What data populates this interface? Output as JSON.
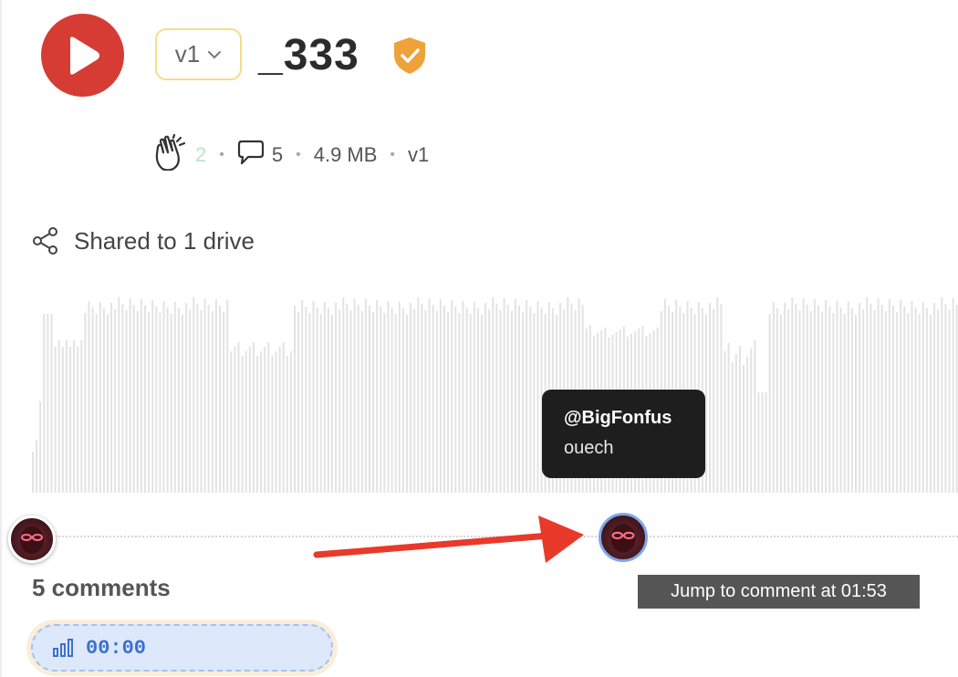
{
  "colors": {
    "play_bg": "#d63b34",
    "version_border": "#f6dd88",
    "verified": "#eea23a",
    "clap_count": "#b8e4c5",
    "tooltip_bg": "#1e1e1e",
    "arrow": "#e8392a",
    "chip_bg": "#dde9fb",
    "chip_text": "#3b6fd4"
  },
  "header": {
    "version_label": "v1",
    "title": "_333"
  },
  "stats": {
    "claps": "2",
    "comments": "5",
    "file_size": "4.9 MB",
    "version": "v1"
  },
  "sharing": {
    "label": "Shared to 1 drive"
  },
  "comment_tooltip": {
    "user": "@BigFonfus",
    "text": "ouech"
  },
  "jump_tooltip": {
    "label": "Jump to comment at 01:53"
  },
  "comments_section": {
    "heading": "5 comments",
    "time_chip": "00:00"
  },
  "icons": {
    "play": "play-icon",
    "chevron": "chevron-down-icon",
    "verified": "verified-shield-icon",
    "clap": "clap-icon",
    "comment": "comment-icon",
    "share": "share-icon",
    "bars": "audio-bars-icon"
  }
}
